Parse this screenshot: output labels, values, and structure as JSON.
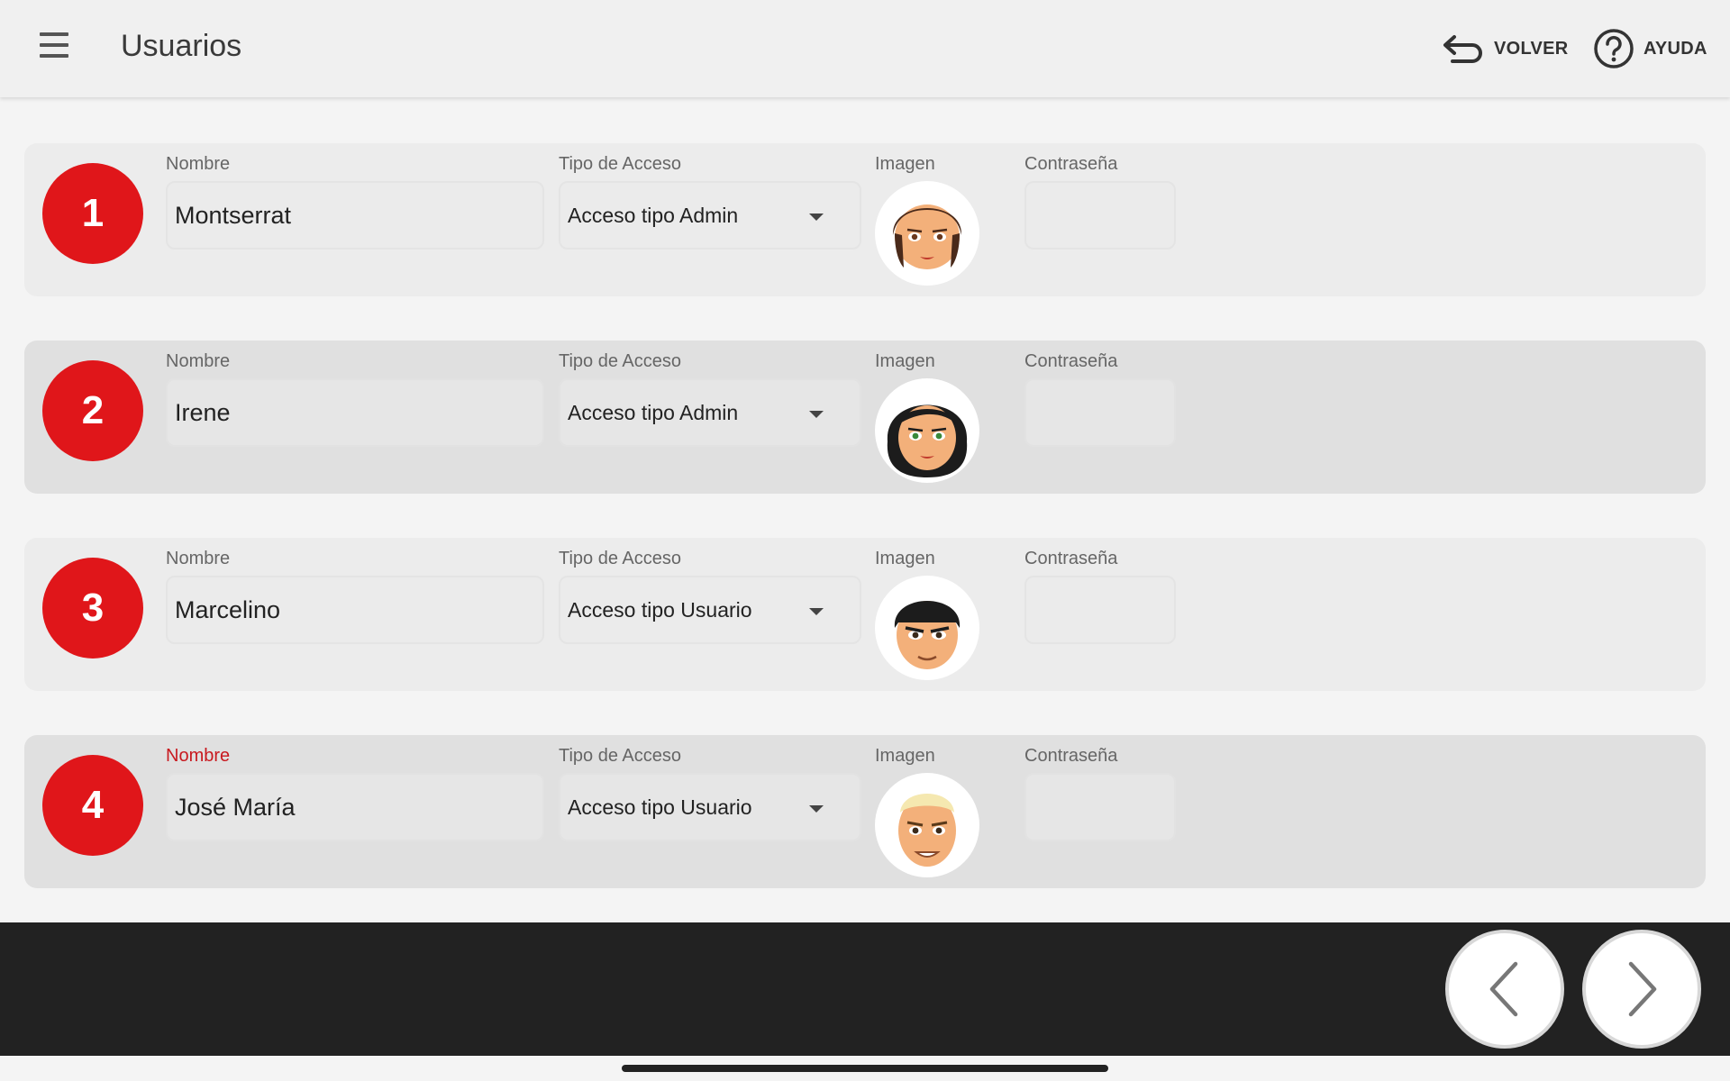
{
  "header": {
    "title": "Usuarios",
    "back_label": "VOLVER",
    "help_label": "AYUDA"
  },
  "fields": {
    "name_label": "Nombre",
    "access_label": "Tipo de Acceso",
    "image_label": "Imagen",
    "password_label": "Contraseña"
  },
  "users": [
    {
      "number": "1",
      "name": "Montserrat",
      "access": "Acceso tipo Admin",
      "avatar": "woman-brown-hair-avatar"
    },
    {
      "number": "2",
      "name": "Irene",
      "access": "Acceso tipo Admin",
      "avatar": "woman-black-hair-avatar"
    },
    {
      "number": "3",
      "name": "Marcelino",
      "access": "Acceso tipo Usuario",
      "avatar": "man-black-hair-avatar"
    },
    {
      "number": "4",
      "name": "José María",
      "access": "Acceso tipo Usuario",
      "avatar": "man-blonde-hair-avatar"
    }
  ],
  "colors": {
    "accent": "#e0161a",
    "error": "#d2232a",
    "footer": "#222222"
  },
  "icons": [
    "menu-icon",
    "back-arrow-icon",
    "help-icon",
    "chevron-left-icon",
    "chevron-right-icon"
  ]
}
